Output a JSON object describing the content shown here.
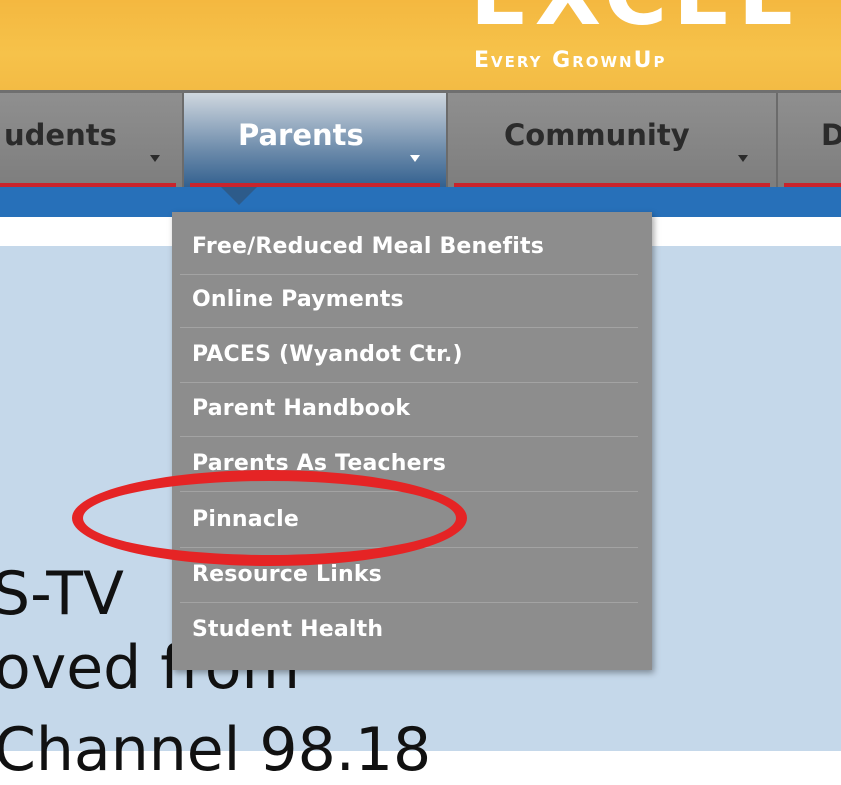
{
  "header": {
    "logo_text": "EXCEL",
    "tagline": "Every GrownUp"
  },
  "nav": {
    "items": [
      {
        "label": "udents"
      },
      {
        "label": "Parents"
      },
      {
        "label": "Community"
      },
      {
        "label": "D"
      }
    ],
    "active_index": 1
  },
  "dropdown": {
    "items": [
      {
        "label": "Free/Reduced Meal Benefits"
      },
      {
        "label": "Online Payments"
      },
      {
        "label": "PACES (Wyandot Ctr.)"
      },
      {
        "label": "Parent Handbook"
      },
      {
        "label": "Parents As Teachers"
      },
      {
        "label": "Pinnacle"
      },
      {
        "label": "Resource Links"
      },
      {
        "label": "Student Health"
      }
    ],
    "highlighted": "Pinnacle"
  },
  "content": {
    "line1": "S-TV",
    "line2": "oved from",
    "line3": "Channel 98.18"
  },
  "colors": {
    "banner": "#f4b840",
    "nav_red": "#c8242d",
    "nav_blue": "#2770b9",
    "dropdown_bg": "#8d8d8d",
    "content_bg": "#c5d8ea",
    "annotation": "#e52425"
  }
}
